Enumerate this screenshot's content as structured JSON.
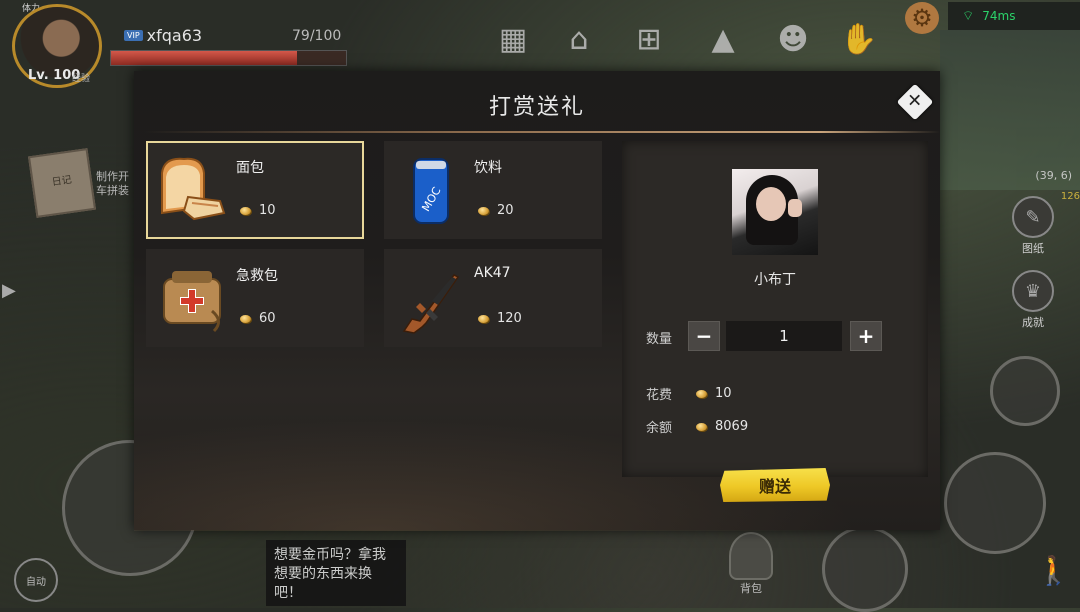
{
  "hud": {
    "stamina_label": "体力",
    "level": "Lv. 100",
    "level_note": "经验",
    "player_name": "xfqa63",
    "hp_text": "79/100",
    "hp_fraction": 0.79,
    "ping": "74ms",
    "coords": "(39, 6)",
    "coord_count": "126",
    "left_tip": "制作开车拼装",
    "notebook_label": "日记",
    "chat_message": "想要金币吗？拿我想要的东西来换吧！",
    "bag_label": "背包",
    "auto_label": "自动",
    "side_buttons": [
      "图纸",
      "成就"
    ]
  },
  "modal": {
    "title": "打赏送礼",
    "close_icon": "close-icon",
    "gifts": [
      {
        "name": "面包",
        "price": "10",
        "icon": "bread-icon",
        "selected": true
      },
      {
        "name": "饮料",
        "price": "20",
        "icon": "soda-can-icon",
        "selected": false
      },
      {
        "name": "急救包",
        "price": "60",
        "icon": "first-aid-kit-icon",
        "selected": false
      },
      {
        "name": "AK47",
        "price": "120",
        "icon": "rifle-icon",
        "selected": false
      }
    ],
    "recipient": {
      "name": "小布丁",
      "qty_label": "数量",
      "qty_value": "1",
      "minus": "−",
      "plus": "+",
      "cost_label": "花费",
      "cost_value": "10",
      "balance_label": "余额",
      "balance_value": "8069"
    },
    "send_label": "赠送"
  },
  "colors": {
    "selected_border": "#e8d79a",
    "send_button": "#eec826",
    "coin": "#d7a139"
  }
}
